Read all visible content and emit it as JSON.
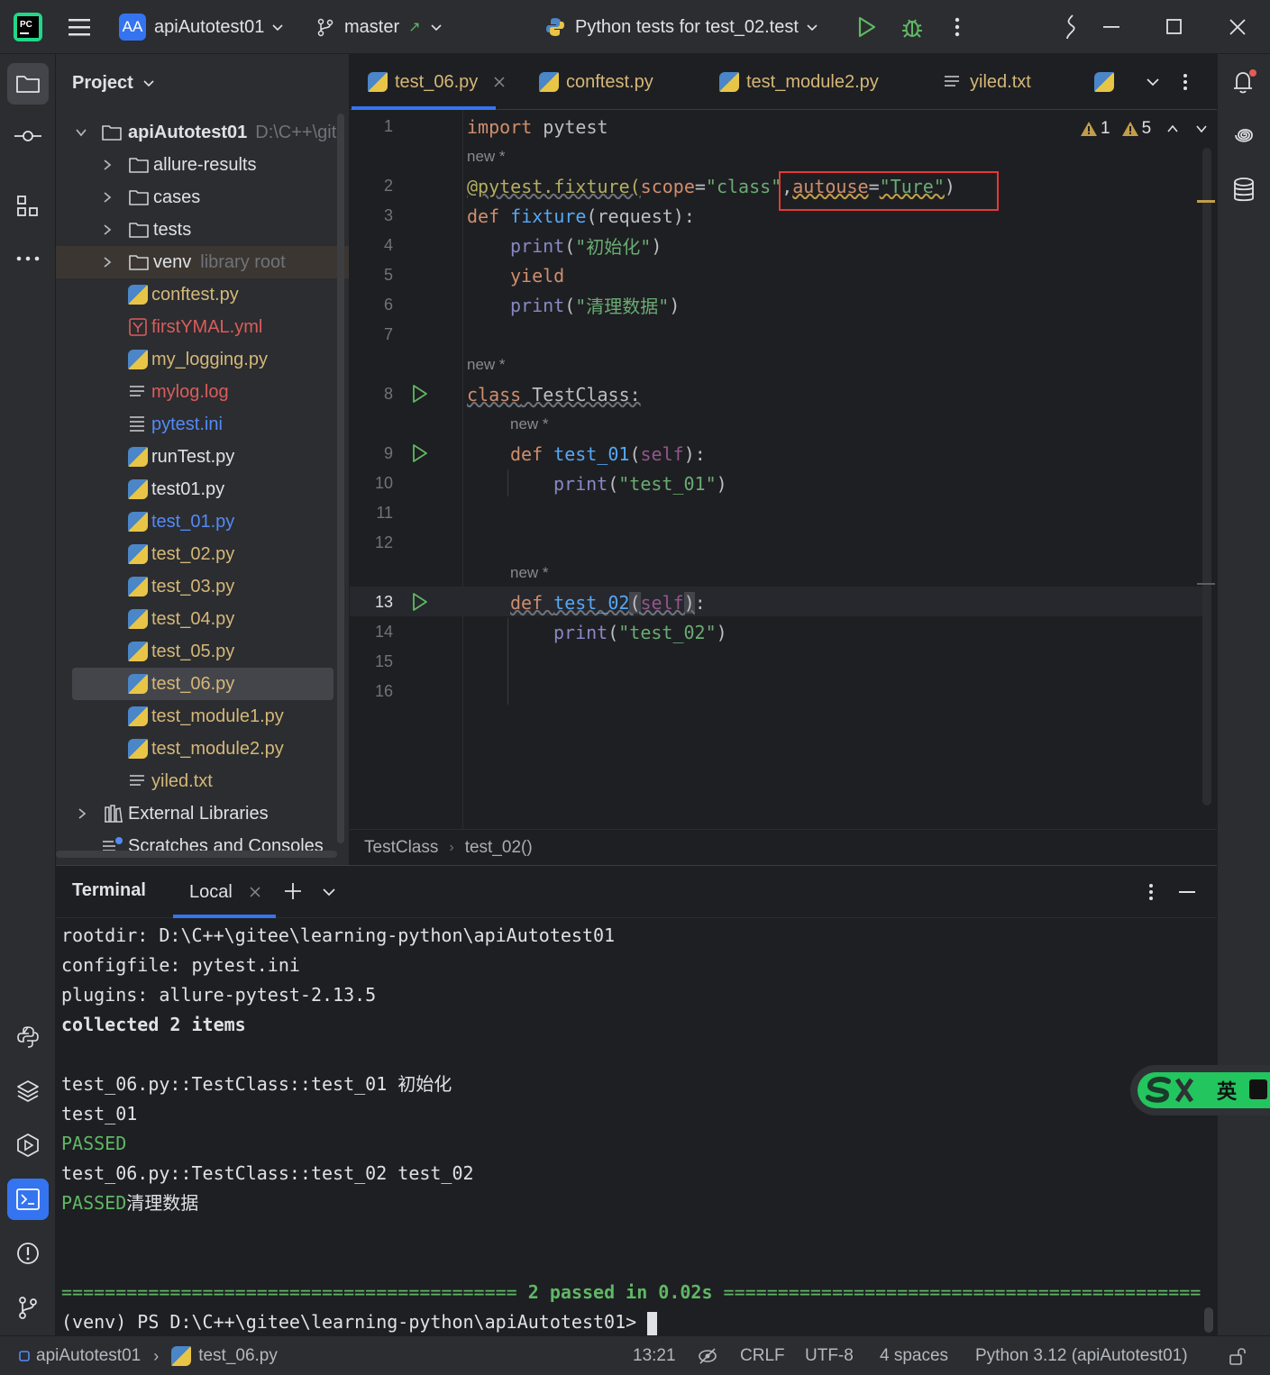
{
  "titlebar": {
    "project_badge": "AA",
    "project_name": "apiAutotest01",
    "branch": "master",
    "run_config": "Python tests for test_02.test"
  },
  "project_panel": {
    "title": "Project",
    "root_name": "apiAutotest01",
    "root_path": "D:\\C++\\git",
    "items": [
      {
        "label": "allure-results",
        "kind": "folder"
      },
      {
        "label": "cases",
        "kind": "folder"
      },
      {
        "label": "tests",
        "kind": "folder"
      },
      {
        "label": "venv",
        "kind": "folder",
        "suffix": "library root"
      },
      {
        "label": "conftest.py",
        "kind": "py"
      },
      {
        "label": "firstYMAL.yml",
        "kind": "yml"
      },
      {
        "label": "my_logging.py",
        "kind": "py"
      },
      {
        "label": "mylog.log",
        "kind": "txt"
      },
      {
        "label": "pytest.ini",
        "kind": "ini"
      },
      {
        "label": "runTest.py",
        "kind": "py"
      },
      {
        "label": "test01.py",
        "kind": "py"
      },
      {
        "label": "test_01.py",
        "kind": "py"
      },
      {
        "label": "test_02.py",
        "kind": "py"
      },
      {
        "label": "test_03.py",
        "kind": "py"
      },
      {
        "label": "test_04.py",
        "kind": "py"
      },
      {
        "label": "test_05.py",
        "kind": "py"
      },
      {
        "label": "test_06.py",
        "kind": "py"
      },
      {
        "label": "test_module1.py",
        "kind": "py"
      },
      {
        "label": "test_module2.py",
        "kind": "py"
      },
      {
        "label": "yiled.txt",
        "kind": "txt"
      },
      {
        "label": "External Libraries",
        "kind": "lib"
      },
      {
        "label": "Scratches and Consoles",
        "kind": "scratch"
      }
    ]
  },
  "editor": {
    "tabs": [
      {
        "label": "test_06.py",
        "active": true
      },
      {
        "label": "conftest.py"
      },
      {
        "label": "test_module2.py"
      },
      {
        "label": "yiled.txt"
      }
    ],
    "inspections": {
      "weak_warnings": "1",
      "warnings": "5"
    },
    "author_hint": "new *",
    "line_numbers": [
      "1",
      "2",
      "3",
      "4",
      "5",
      "6",
      "7",
      "8",
      "9",
      "10",
      "11",
      "12",
      "13",
      "14",
      "15",
      "16"
    ],
    "breadcrumbs": [
      "TestClass",
      "test_02()"
    ]
  },
  "code": {
    "l1": [
      "import",
      " pytest"
    ],
    "l2": [
      "@pytest.fixture(",
      "scope",
      "=",
      "\"class\"",
      ",",
      "autouse",
      "=",
      "\"Ture\"",
      ")"
    ],
    "l3": [
      "def ",
      "fixture",
      "(request):"
    ],
    "l4": [
      "print",
      "(",
      "\"初始化\"",
      ")"
    ],
    "l5": [
      "yield"
    ],
    "l6": [
      "print",
      "(",
      "\"清理数据\"",
      ")"
    ],
    "l8": [
      "class",
      " TestClass:"
    ],
    "l9": [
      "def ",
      "test_01",
      "(",
      "self",
      "):"
    ],
    "l10": [
      "print",
      "(",
      "\"test_01\"",
      ")"
    ],
    "l13": [
      "def ",
      "test_02",
      "(",
      "self",
      ")",
      ":"
    ],
    "l14": [
      "print",
      "(",
      "\"test_02\"",
      ")"
    ]
  },
  "terminal": {
    "title": "Terminal",
    "tab": "Local",
    "lines": [
      "rootdir: D:\\C++\\gitee\\learning-python\\apiAutotest01",
      "configfile: pytest.ini",
      "plugins: allure-pytest-2.13.5",
      "collected 2 items",
      "",
      "test_06.py::TestClass::test_01 初始化",
      "test_01",
      "PASSED",
      "test_06.py::TestClass::test_02 test_02",
      "PASSED清理数据"
    ],
    "summary_rule_left": "==========================================",
    "summary_text": "2 passed in 0.02s",
    "summary_rule_right": "============================================",
    "prompt": "(venv) PS D:\\C++\\gitee\\learning-python\\apiAutotest01>"
  },
  "status": {
    "project": "apiAutotest01",
    "file": "test_06.py",
    "position": "13:21",
    "line_sep": "CRLF",
    "encoding": "UTF-8",
    "indent": "4 spaces",
    "interpreter": "Python 3.12 (apiAutotest01)"
  },
  "ime": {
    "label": "英"
  },
  "colors": {
    "accent": "#3574f0",
    "highlight_box": "#e53935",
    "keyword": "#cf8e6d",
    "function": "#56a8f5",
    "string": "#6aab73",
    "passed": "#5fb865"
  }
}
